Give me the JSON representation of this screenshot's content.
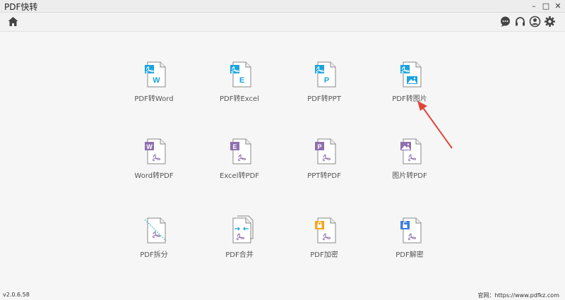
{
  "window": {
    "title": "PDF快转",
    "controls": [
      "minimize",
      "maximize",
      "close"
    ]
  },
  "toolbar": {
    "home_icon": "home-icon",
    "right_icons": [
      "chat-icon",
      "headset-icon",
      "user-icon",
      "gear-icon"
    ]
  },
  "tools": [
    {
      "label": "PDF转Word",
      "badge": "W",
      "kind": "pdf-to"
    },
    {
      "label": "PDF转Excel",
      "badge": "E",
      "kind": "pdf-to"
    },
    {
      "label": "PDF转PPT",
      "badge": "P",
      "kind": "pdf-to"
    },
    {
      "label": "PDF转图片",
      "badge": "",
      "kind": "pdf-to-image"
    },
    {
      "label": "Word转PDF",
      "badge": "W",
      "kind": "to-pdf"
    },
    {
      "label": "Excel转PDF",
      "badge": "E",
      "kind": "to-pdf"
    },
    {
      "label": "PPT转PDF",
      "badge": "P",
      "kind": "to-pdf"
    },
    {
      "label": "图片转PDF",
      "badge": "",
      "kind": "image-to-pdf"
    },
    {
      "label": "PDF拆分",
      "badge": "",
      "kind": "split"
    },
    {
      "label": "PDF合并",
      "badge": "",
      "kind": "merge"
    },
    {
      "label": "PDF加密",
      "badge": "",
      "kind": "encrypt"
    },
    {
      "label": "PDF解密",
      "badge": "",
      "kind": "decrypt"
    }
  ],
  "colors": {
    "pdf_blue": "#1aa3dd",
    "office_purple": "#8f6fae",
    "encrypt_orange": "#f5a623",
    "decrypt_blue": "#3c7fe0",
    "arrow_red": "#e0453a"
  },
  "footer": {
    "version": "v2.0.6.58",
    "website": "官网：https://www.pdfkz.com"
  }
}
